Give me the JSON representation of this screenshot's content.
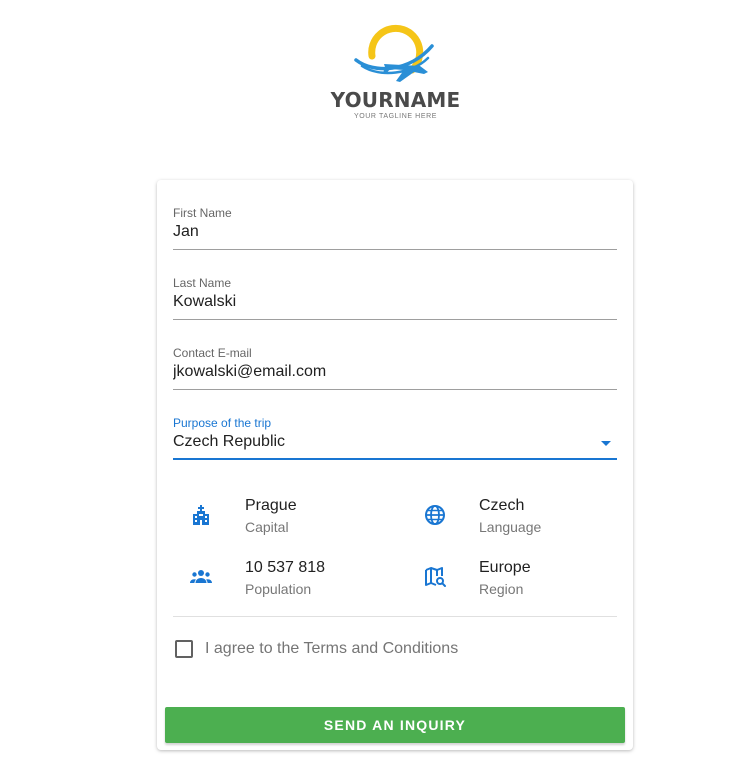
{
  "logo": {
    "brand": "YOURNAME",
    "tagline": "YOUR TAGLINE HERE"
  },
  "form": {
    "first_name": {
      "label": "First Name",
      "value": "Jan"
    },
    "last_name": {
      "label": "Last Name",
      "value": "Kowalski"
    },
    "email": {
      "label": "Contact E-mail",
      "value": "jkowalski@email.com"
    },
    "purpose": {
      "label": "Purpose of the trip",
      "value": "Czech Republic"
    }
  },
  "country_info": {
    "capital": {
      "value": "Prague",
      "label": "Capital",
      "icon": "city-icon"
    },
    "language": {
      "value": "Czech",
      "label": "Language",
      "icon": "globe-icon"
    },
    "population": {
      "value": "10 537 818",
      "label": "Population",
      "icon": "people-icon"
    },
    "region": {
      "value": "Europe",
      "label": "Region",
      "icon": "map-search-icon"
    }
  },
  "terms": {
    "label": "I agree to the Terms and Conditions",
    "checked": false
  },
  "submit": {
    "label": "SEND AN INQUIRY"
  },
  "colors": {
    "accent": "#1976d2",
    "button": "#4caf50",
    "logo_yellow": "#f5c518",
    "logo_blue": "#2a8fd6"
  }
}
